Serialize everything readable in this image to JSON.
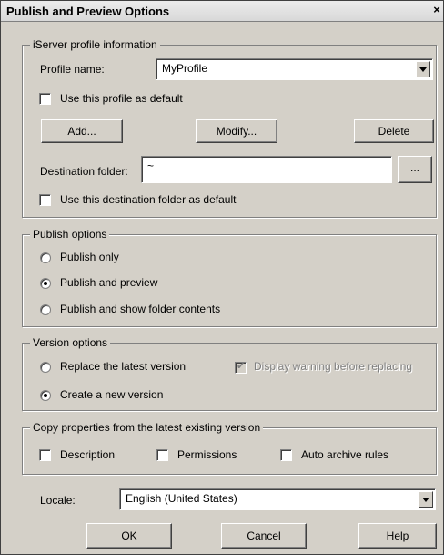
{
  "window": {
    "title": "Publish and Preview Options",
    "close_glyph": "×"
  },
  "profile": {
    "legend": "iServer profile information",
    "name_label": "Profile name:",
    "name_value": "MyProfile",
    "use_default_label": "Use this profile as default",
    "add_label": "Add...",
    "modify_label": "Modify...",
    "delete_label": "Delete",
    "dest_label": "Destination folder:",
    "dest_value": "~",
    "browse_label": "...",
    "dest_default_label": "Use this destination folder as default"
  },
  "publish": {
    "legend": "Publish options",
    "options": [
      {
        "label": "Publish only",
        "selected": false
      },
      {
        "label": "Publish and preview",
        "selected": true
      },
      {
        "label": "Publish and show folder contents",
        "selected": false
      }
    ]
  },
  "version": {
    "legend": "Version options",
    "replace_label": "Replace the latest version",
    "create_label": "Create a new version",
    "selected": "create",
    "warning_label": "Display warning before replacing",
    "warning_checked": true,
    "warning_enabled": false
  },
  "copy": {
    "legend": "Copy properties from the latest existing version",
    "description_label": "Description",
    "permissions_label": "Permissions",
    "archive_label": "Auto archive rules"
  },
  "locale": {
    "label": "Locale:",
    "value": "English (United States)"
  },
  "footer": {
    "ok_label": "OK",
    "cancel_label": "Cancel",
    "help_label": "Help"
  },
  "colors": {
    "face": "#d4d0c8",
    "shadow": "#808080",
    "dark": "#404040",
    "disabled_text": "#808080"
  }
}
